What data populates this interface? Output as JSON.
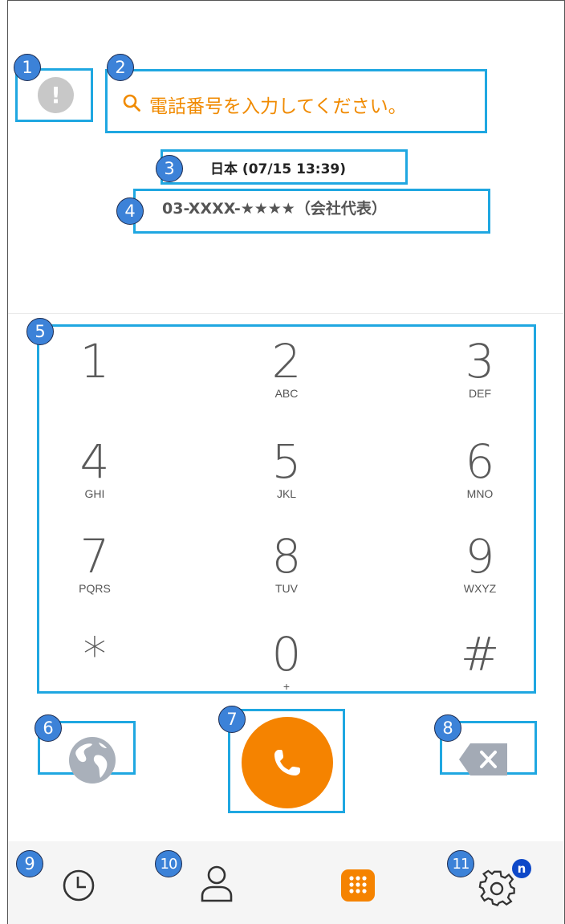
{
  "search": {
    "placeholder": "電話番号を入力してください。"
  },
  "alert": {
    "glyph": "!"
  },
  "country_time": "日本 (07/15 13:39)",
  "selected_number": "03-XXXX-★★★★（会社代表）",
  "keypad": [
    {
      "digit": "1",
      "letters": ""
    },
    {
      "digit": "2",
      "letters": "ABC"
    },
    {
      "digit": "3",
      "letters": "DEF"
    },
    {
      "digit": "4",
      "letters": "GHI"
    },
    {
      "digit": "5",
      "letters": "JKL"
    },
    {
      "digit": "6",
      "letters": "MNO"
    },
    {
      "digit": "7",
      "letters": "PQRS"
    },
    {
      "digit": "8",
      "letters": "TUV"
    },
    {
      "digit": "9",
      "letters": "WXYZ"
    },
    {
      "digit": "*",
      "letters": ""
    },
    {
      "digit": "0",
      "letters": "+"
    },
    {
      "digit": "#",
      "letters": ""
    }
  ],
  "badges": [
    "1",
    "2",
    "3",
    "4",
    "5",
    "6",
    "7",
    "8",
    "9",
    "10",
    "11"
  ],
  "settings_badge": "n",
  "icons": {
    "alert": "alert-icon",
    "search": "search-icon",
    "globe": "globe-icon",
    "call": "phone-icon",
    "backspace": "backspace-icon",
    "history": "clock-icon",
    "contacts": "person-icon",
    "dialpad": "dialpad-icon",
    "settings": "gear-icon"
  },
  "colors": {
    "accent": "#f58300",
    "highlight": "#1fa7e1",
    "badge": "#3c82d8",
    "notify": "#0e48c8"
  }
}
